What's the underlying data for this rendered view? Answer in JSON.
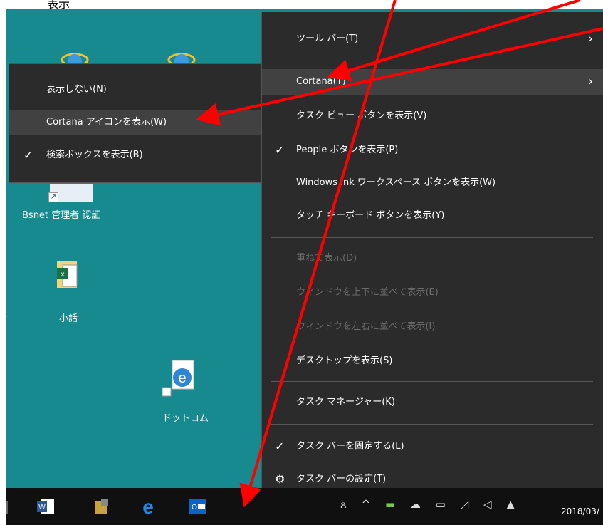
{
  "top_fragment": "表示",
  "desktop": {
    "icons": [
      {
        "label": "Bsnet 管理者 認証"
      },
      {
        "label": "小話"
      },
      {
        "label": "ドットコム"
      }
    ],
    "edge_text": "3"
  },
  "submenu": {
    "items": [
      {
        "label": "表示しない(N)",
        "checked": ""
      },
      {
        "label": "Cortana アイコンを表示(W)",
        "checked": ""
      },
      {
        "label": "検索ボックスを表示(B)",
        "checked": "✓"
      }
    ]
  },
  "mainmenu": {
    "items": [
      {
        "label": "ツール バー(T)"
      },
      {
        "label": "Cortana(T)"
      },
      {
        "label": "タスク ビュー ボタンを表示(V)"
      },
      {
        "label": "People ボタンを表示(P)",
        "checked": "✓"
      },
      {
        "label": "Windows Ink ワークスペース ボタンを表示(W)"
      },
      {
        "label": "タッチ キーボード ボタンを表示(Y)"
      },
      {
        "label": "重ねて表示(D)"
      },
      {
        "label": "ウィンドウを上下に並べて表示(E)"
      },
      {
        "label": "ウィンドウを左右に並べて表示(I)"
      },
      {
        "label": "デスクトップを表示(S)"
      },
      {
        "label": "タスク マネージャー(K)"
      },
      {
        "label": "タスク バーを固定する(L)",
        "checked": "✓"
      },
      {
        "label": "タスク バーの設定(T)",
        "icon": "⚙"
      }
    ],
    "submenu_arrow": "›"
  },
  "taskbar": {
    "date": "2018/03/"
  },
  "colors": {
    "desktop": "#168a8f",
    "menu_bg": "#2b2b2b",
    "hover": "#414141",
    "annotation": "#ff0000"
  }
}
